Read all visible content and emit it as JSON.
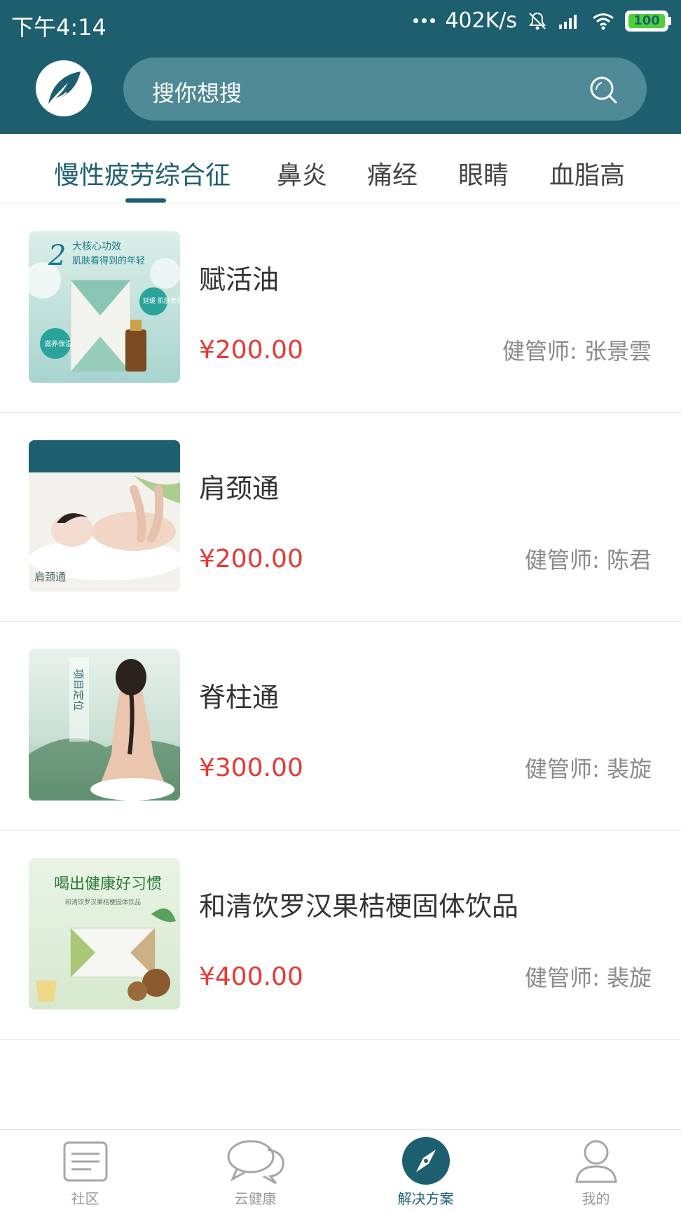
{
  "status_bar": {
    "time": "下午4:14",
    "network_speed": "402K/s",
    "battery_level": "100"
  },
  "search": {
    "placeholder": "搜你想搜",
    "icon": "search-icon"
  },
  "tabs": [
    {
      "label": "慢性疲劳综合征",
      "active": true
    },
    {
      "label": "鼻炎",
      "active": false
    },
    {
      "label": "痛经",
      "active": false
    },
    {
      "label": "眼睛",
      "active": false
    },
    {
      "label": "血脂高",
      "active": false
    }
  ],
  "products": [
    {
      "name": "赋活油",
      "price": "¥200.00",
      "manager": "健管师: 张景雲",
      "thumb_text": [
        "2",
        "大核心功效",
        "肌肤看得到的年轻",
        "延缓 肌肤老化",
        "滋养保湿"
      ]
    },
    {
      "name": "肩颈通",
      "price": "¥200.00",
      "manager": "健管师: 陈君",
      "thumb_text": [
        "肩颈通"
      ]
    },
    {
      "name": "脊柱通",
      "price": "¥300.00",
      "manager": "健管师: 裴旋",
      "thumb_text": [
        "项目定位"
      ]
    },
    {
      "name": "和清饮罗汉果桔梗固体饮品",
      "price": "¥400.00",
      "manager": "健管师: 裴旋",
      "thumb_text": [
        "喝出健康好习惯",
        "和清饮罗汉果桔梗固体饮品"
      ]
    }
  ],
  "bottom_nav": [
    {
      "label": "社区",
      "icon": "document-icon",
      "active": false
    },
    {
      "label": "云健康",
      "icon": "chat-bubbles-icon",
      "active": false
    },
    {
      "label": "解决方案",
      "icon": "compass-icon",
      "active": true
    },
    {
      "label": "我的",
      "icon": "user-icon",
      "active": false
    }
  ],
  "colors": {
    "primary": "#1e5f6f",
    "search_bg": "#4f8a96",
    "price": "#e53935",
    "muted_text": "#8a8a8a"
  }
}
